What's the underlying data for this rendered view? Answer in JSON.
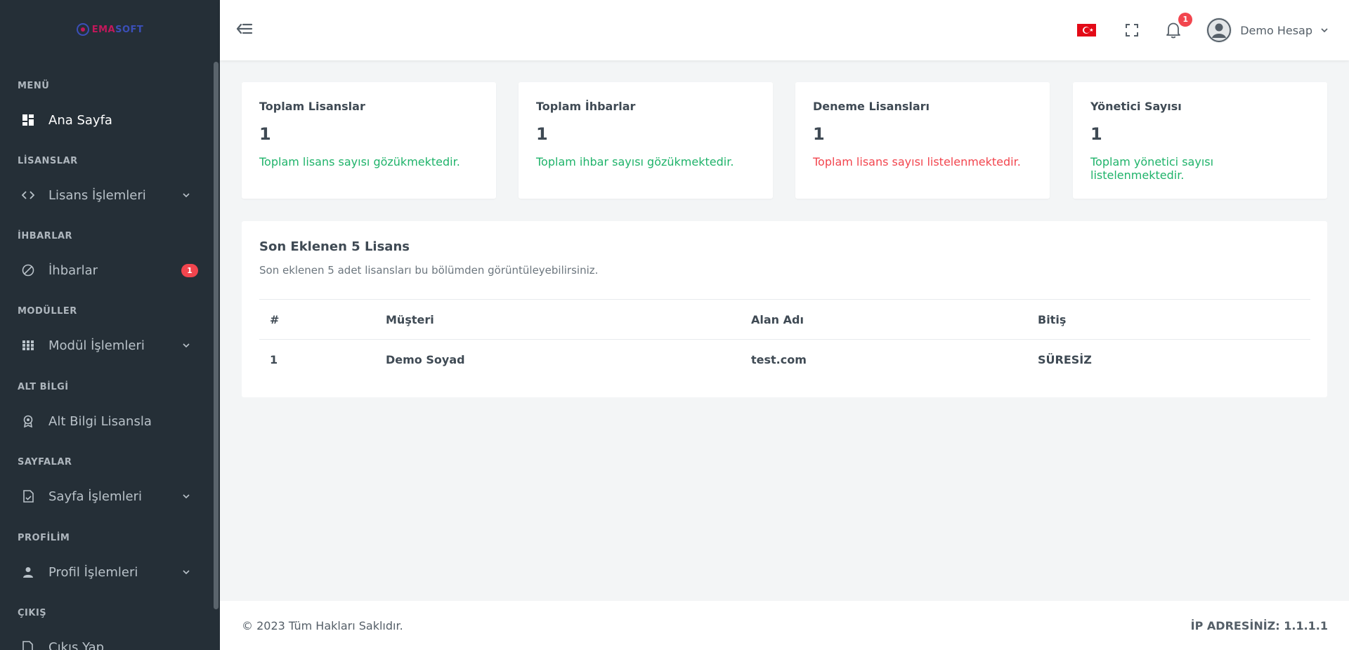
{
  "brand": {
    "logo_part1": "EMA",
    "logo_part2": "SOFT"
  },
  "sidebar": {
    "sections": [
      {
        "title": "MENÜ",
        "items": [
          {
            "label": "Ana Sayfa",
            "icon": "dashboard-icon",
            "active": true
          }
        ]
      },
      {
        "title": "LİSANSLAR",
        "items": [
          {
            "label": "Lisans İşlemleri",
            "icon": "code-icon",
            "has_submenu": true
          }
        ]
      },
      {
        "title": "İHBARLAR",
        "items": [
          {
            "label": "İhbarlar",
            "icon": "block-icon",
            "badge": "1"
          }
        ]
      },
      {
        "title": "MODÜLLER",
        "items": [
          {
            "label": "Modül İşlemleri",
            "icon": "grid-icon",
            "has_submenu": true
          }
        ]
      },
      {
        "title": "ALT BİLGİ",
        "items": [
          {
            "label": "Alt Bilgi Lisansla",
            "icon": "award-icon"
          }
        ]
      },
      {
        "title": "SAYFALAR",
        "items": [
          {
            "label": "Sayfa İşlemleri",
            "icon": "file-check-icon",
            "has_submenu": true
          }
        ]
      },
      {
        "title": "PROFİLİM",
        "items": [
          {
            "label": "Profil İşlemleri",
            "icon": "user-icon",
            "has_submenu": true
          }
        ]
      },
      {
        "title": "ÇIKIŞ",
        "items": [
          {
            "label": "Çıkış Yap",
            "icon": "logout-icon"
          }
        ]
      }
    ]
  },
  "header": {
    "language_flag": "tr-flag-icon",
    "notification_count": "1",
    "user_name": "Demo Hesap"
  },
  "stats": [
    {
      "title": "Toplam Lisanslar",
      "value": "1",
      "note": "Toplam lisans sayısı gözükmektedir.",
      "note_color": "#1fb36a"
    },
    {
      "title": "Toplam İhbarlar",
      "value": "1",
      "note": "Toplam ihbar sayısı gözükmektedir.",
      "note_color": "#1fb36a"
    },
    {
      "title": "Deneme Lisansları",
      "value": "1",
      "note": "Toplam lisans sayısı listelenmektedir.",
      "note_color": "#f2454e"
    },
    {
      "title": "Yönetici Sayısı",
      "value": "1",
      "note": "Toplam yönetici sayısı listelenmektedir.",
      "note_color": "#1fb36a"
    }
  ],
  "recent": {
    "title": "Son Eklenen 5 Lisans",
    "subtitle": "Son eklenen 5 adet lisansları bu bölümden görüntüleyebilirsiniz.",
    "columns": [
      "#",
      "Müşteri",
      "Alan Adı",
      "Bitiş"
    ],
    "rows": [
      [
        "1",
        "Demo Soyad",
        "test.com",
        "SÜRESİZ"
      ]
    ]
  },
  "footer": {
    "copyright": "© 2023 Tüm Hakları Saklıdır.",
    "ip": "İP ADRESİNİZ: 1.1.1.1"
  },
  "colors": {
    "sidebar_bg": "#252f37",
    "accent_green": "#1fb36a",
    "accent_red": "#f2454e"
  }
}
